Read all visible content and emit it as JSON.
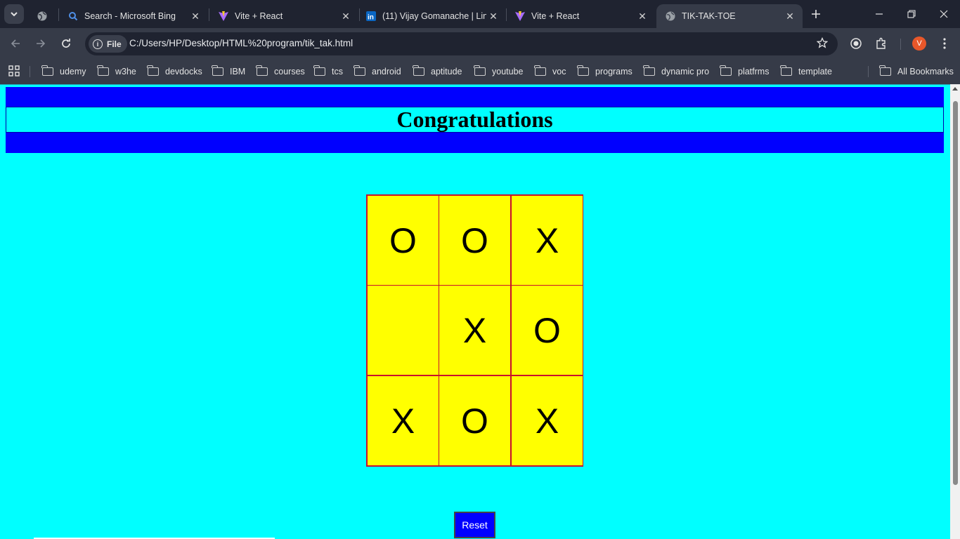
{
  "browser": {
    "tabs": [
      {
        "title": "",
        "icon": "globe-icon"
      },
      {
        "title": "Search - Microsoft Bing",
        "icon": "search-icon"
      },
      {
        "title": "Vite + React",
        "icon": "vite-icon"
      },
      {
        "title": "(11) Vijay Gomanache | Lin",
        "icon": "linkedin-icon"
      },
      {
        "title": "Vite + React",
        "icon": "vite-icon"
      },
      {
        "title": "TIK-TAK-TOE",
        "icon": "globe-icon"
      }
    ],
    "active_tab_index": 5,
    "omnibox": {
      "scheme_label": "File",
      "url": "C:/Users/HP/Desktop/HTML%20program/tik_tak.html"
    },
    "profile_initial": "V",
    "bookmarks": [
      "udemy",
      "w3he",
      "devdocks",
      "IBM",
      "courses",
      "tcs",
      "android",
      "aptitude",
      "youtube",
      "voc",
      "programs",
      "dynamic pro",
      "platfrms",
      "template"
    ],
    "all_bookmarks_label": "All Bookmarks"
  },
  "page": {
    "heading": "Congratulations",
    "board": [
      [
        "O",
        "O",
        "X"
      ],
      [
        "",
        "X",
        "O"
      ],
      [
        "X",
        "O",
        "X"
      ]
    ],
    "reset_label": "Reset",
    "colors": {
      "background": "#00ffff",
      "header_band": "#0000ff",
      "cell": "#ffff00",
      "cell_border": "#c8102e",
      "reset_button": "#0000ff"
    }
  }
}
